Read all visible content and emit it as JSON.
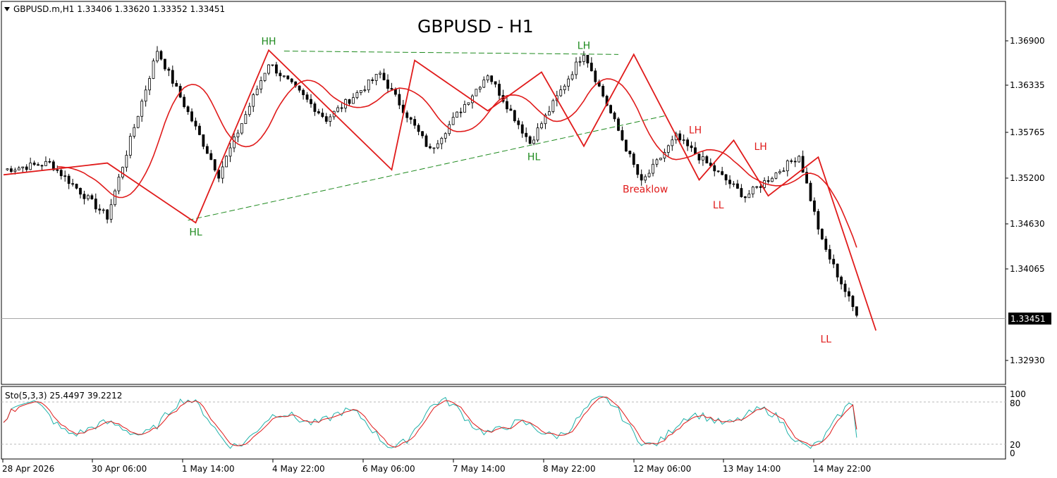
{
  "header": {
    "symbol_info": "GBPUSD.m,H1  1.33406 1.33620 1.33352 1.33451",
    "chart_title": "GBPUSD - H1"
  },
  "price_axis": {
    "ticks": [
      "1.36900",
      "1.36335",
      "1.35765",
      "1.35200",
      "1.34630",
      "1.34065",
      "1.33451",
      "1.32930"
    ],
    "current_price": "1.33451"
  },
  "oscillator": {
    "label": "Sto(5,3,3) 25.4497 39.2212",
    "levels": [
      "100",
      "80",
      "20",
      "0"
    ]
  },
  "time_axis": {
    "labels": [
      "28 Apr 2026",
      "30 Apr 06:00",
      "1 May 14:00",
      "4 May 22:00",
      "6 May 06:00",
      "7 May 14:00",
      "8 May 22:00",
      "12 May 06:00",
      "13 May 14:00",
      "14 May 22:00"
    ]
  },
  "annotations": [
    {
      "text": "HH",
      "color": "#1e8a1e"
    },
    {
      "text": "HL",
      "color": "#1e8a1e"
    },
    {
      "text": "LH",
      "color": "#1e8a1e"
    },
    {
      "text": "HL",
      "color": "#1e8a1e"
    },
    {
      "text": "LH",
      "color": "#e01b1b"
    },
    {
      "text": "LH",
      "color": "#e01b1b"
    },
    {
      "text": "Breaklow",
      "color": "#e01b1b"
    },
    {
      "text": "LL",
      "color": "#e01b1b"
    },
    {
      "text": "LL",
      "color": "#e01b1b"
    }
  ],
  "colors": {
    "candle": "#000000",
    "zigzag": "#e01b1b",
    "moving_average": "#e01b1b",
    "trendline": "#1e8a1e",
    "stoch_main": "#20b2aa",
    "stoch_signal": "#e01b1b"
  },
  "chart_data": {
    "type": "line",
    "title": "GBPUSD - H1",
    "ylim": [
      1.3263,
      1.3718
    ],
    "x_ticks": [
      "28 Apr 2026",
      "30 Apr 06:00",
      "1 May 14:00",
      "4 May 22:00",
      "6 May 06:00",
      "7 May 14:00",
      "8 May 22:00",
      "12 May 06:00",
      "13 May 14:00",
      "14 May 22:00"
    ],
    "series": [
      {
        "name": "",
        "style": "candles-approx",
        "x_index": [
          0,
          12,
          27,
          40,
          56,
          69,
          84,
          98,
          111,
          126,
          137,
          151,
          166,
          175,
          193,
          207,
          213,
          222
        ],
        "values": [
          1.3518,
          1.3526,
          1.3462,
          1.366,
          1.3512,
          1.3645,
          1.3578,
          1.3632,
          1.3541,
          1.3632,
          1.355,
          1.3658,
          1.3502,
          1.3557,
          1.3486,
          1.3535,
          1.3432,
          1.3345
        ]
      }
    ],
    "zigzag": {
      "x_index": [
        0,
        27,
        50,
        69,
        101,
        107,
        126,
        140,
        151,
        164,
        181,
        190,
        199,
        212,
        227
      ],
      "values": [
        1.3512,
        1.3526,
        1.3455,
        1.366,
        1.3518,
        1.3648,
        1.3588,
        1.3634,
        1.3546,
        1.3655,
        1.3506,
        1.3553,
        1.3487,
        1.3533,
        1.3327
      ]
    },
    "trendlines": [
      {
        "x_index": [
          48,
          172
        ],
        "values": [
          1.3458,
          1.3582
        ]
      },
      {
        "x_index": [
          73,
          160
        ],
        "values": [
          1.3659,
          1.3655
        ]
      }
    ],
    "price_levels": [
      "1.36900",
      "1.36335",
      "1.35765",
      "1.35200",
      "1.34630",
      "1.34065",
      "1.32930"
    ],
    "current_price": 1.33451,
    "annotations": [
      {
        "text": "HH",
        "x_index": 69,
        "y": 1.366
      },
      {
        "text": "HL",
        "x_index": 50,
        "y": 1.3455
      },
      {
        "text": "LH",
        "x_index": 151,
        "y": 1.3655
      },
      {
        "text": "HL",
        "x_index": 138,
        "y": 1.3546
      },
      {
        "text": "LH",
        "x_index": 180,
        "y": 1.3553
      },
      {
        "text": "LH",
        "x_index": 197,
        "y": 1.3533
      },
      {
        "text": "Breaklow",
        "x_index": 167,
        "y": 1.3506
      },
      {
        "text": "LL",
        "x_index": 186,
        "y": 1.3487
      },
      {
        "text": "LL",
        "x_index": 214,
        "y": 1.3327
      }
    ],
    "stochastic": {
      "label": "Sto(5,3,3) 25.4497 39.2212",
      "main": 25.4497,
      "signal": 39.2212,
      "levels": [
        20,
        80
      ],
      "ylim": [
        0,
        100
      ]
    }
  }
}
